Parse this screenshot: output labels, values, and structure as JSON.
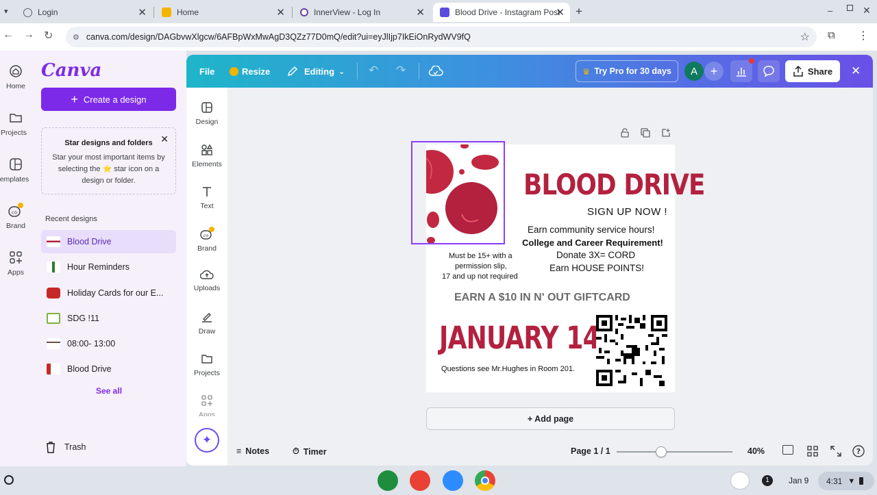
{
  "browser": {
    "tabs": [
      {
        "title": "Login"
      },
      {
        "title": "Home"
      },
      {
        "title": "InnerView - Log In"
      },
      {
        "title": "Blood Drive - Instagram Post"
      }
    ],
    "url": "canva.com/design/DAGbvwXlgcw/6AFBpWxMwAgD3QZz77D0mQ/edit?ui=eyJlIjp7IkEiOnRydWV9fQ"
  },
  "rail": {
    "items": [
      {
        "label": "Home"
      },
      {
        "label": "Projects"
      },
      {
        "label": "emplates"
      },
      {
        "label": "Brand"
      },
      {
        "label": "Apps"
      }
    ]
  },
  "sidebar": {
    "logo": "Canva",
    "create_label": "Create a design",
    "tip_title": "Star designs and folders",
    "tip_body": "Star your most important items by selecting the ⭐ star icon on a design or folder.",
    "recent_title": "Recent designs",
    "recent": [
      {
        "label": "Blood Drive"
      },
      {
        "label": "Hour Reminders"
      },
      {
        "label": "Holiday Cards for our E..."
      },
      {
        "label": "SDG !11"
      },
      {
        "label": "08:00- 13:00"
      },
      {
        "label": "Blood Drive"
      }
    ],
    "see_all": "See all",
    "trash": "Trash"
  },
  "topbar": {
    "file": "File",
    "resize": "Resize",
    "editing": "Editing",
    "try_pro": "Try Pro for 30 days",
    "avatar": "A",
    "share": "Share"
  },
  "tools": [
    {
      "label": "Design"
    },
    {
      "label": "Elements"
    },
    {
      "label": "Text"
    },
    {
      "label": "Brand"
    },
    {
      "label": "Uploads"
    },
    {
      "label": "Draw"
    },
    {
      "label": "Projects"
    },
    {
      "label": "Apps"
    }
  ],
  "design": {
    "title": "BLOOD DRIVE",
    "signup": "SIGN UP NOW !",
    "line1": "Earn community service hours!",
    "line2": "College and Career Requirement!",
    "line3": "Donate 3X= CORD",
    "line4": "Earn HOUSE POINTS!",
    "age_note1": "Must  be 15+ with a",
    "age_note2": "permission slip,",
    "age_note3": "17 and up not required",
    "giftcard": "EARN A $10 IN N' OUT GIFTCARD",
    "date": "JANUARY 14",
    "questions": "Questions see Mr.Hughes in Room 201."
  },
  "canvas": {
    "add_page": "+ Add page",
    "notes": "Notes",
    "timer": "Timer",
    "page_indicator": "Page 1 / 1",
    "zoom": "40%",
    "zoom_level": 0.4
  },
  "shelf": {
    "date": "Jan 9",
    "time": "4:31",
    "notif_count": "1"
  },
  "colors": {
    "canva_purple": "#7d2ae8",
    "blood_red": "#b3213f"
  }
}
